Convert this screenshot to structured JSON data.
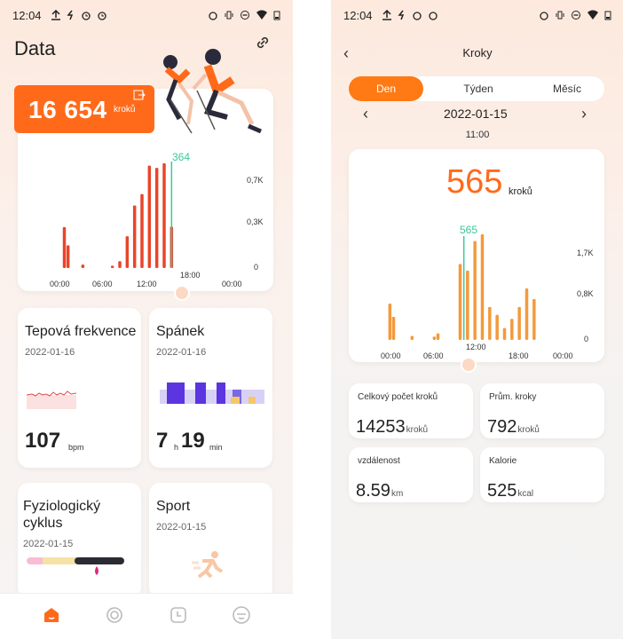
{
  "status_bar": {
    "time": "12:04"
  },
  "left": {
    "title": "Data",
    "steps": {
      "value": "16 654",
      "unit": "kroků"
    },
    "chart": {
      "highlight_label": "364",
      "y_labels": [
        "0,7K",
        "0,3K",
        "0"
      ],
      "x_labels": [
        "00:00",
        "06:00",
        "12:00",
        "18:00",
        "00:00"
      ]
    },
    "heart": {
      "title": "Tepová frekvence",
      "date": "2022-01-16",
      "value": "107",
      "unit": "bpm"
    },
    "sleep": {
      "title": "Spánek",
      "date": "2022-01-16",
      "hours": "7",
      "h_unit": "h",
      "minutes": "19",
      "min_unit": "min"
    },
    "cycle": {
      "title_line1": "Fyziologický",
      "title_line2": "cyklus",
      "date": "2022-01-15"
    },
    "sport": {
      "title": "Sport",
      "date": "2022-01-15"
    },
    "nav": [
      "home-icon",
      "activity-icon",
      "clock-icon",
      "profile-icon"
    ]
  },
  "right": {
    "title": "Kroky",
    "tabs": [
      {
        "label": "Den",
        "active": true
      },
      {
        "label": "Týden",
        "active": false
      },
      {
        "label": "Měsíc",
        "active": false
      }
    ],
    "date": "2022-01-15",
    "hour": "11:00",
    "big_value": "565",
    "big_unit": "kroků",
    "chart": {
      "highlight_label": "565",
      "y_labels": [
        "1,7K",
        "0,8K",
        "0"
      ],
      "x_labels": [
        "00:00",
        "06:00",
        "12:00",
        "18:00",
        "00:00"
      ]
    },
    "stats": [
      {
        "label": "Celkový počet kroků",
        "value": "14253",
        "unit": "kroků"
      },
      {
        "label": "Prům. kroky",
        "value": "792",
        "unit": "kroků"
      },
      {
        "label": "vzdálenost",
        "value": "8.59",
        "unit": "km"
      },
      {
        "label": "Kalorie",
        "value": "525",
        "unit": "kcal"
      }
    ]
  },
  "colors": {
    "accent": "#ff6a1a",
    "bar_left": "#e8452c",
    "bar_right": "#f39a3c",
    "highlight": "#3cc79a"
  },
  "chart_data": [
    {
      "type": "bar",
      "x_range": [
        "00:00",
        "00:00"
      ],
      "x_labels": [
        "00:00",
        "06:00",
        "12:00",
        "18:00",
        "00:00"
      ],
      "y_ticks": [
        "0",
        "0,3K",
        "0,7K"
      ],
      "values": [
        {
          "x": 1.5,
          "y": 0.36
        },
        {
          "x": 2,
          "y": 0.2
        },
        {
          "x": 4,
          "y": 0.03
        },
        {
          "x": 8,
          "y": 0.02
        },
        {
          "x": 9,
          "y": 0.06
        },
        {
          "x": 10,
          "y": 0.28
        },
        {
          "x": 11,
          "y": 0.55
        },
        {
          "x": 12,
          "y": 0.65
        },
        {
          "x": 13,
          "y": 0.9
        },
        {
          "x": 14,
          "y": 0.88
        },
        {
          "x": 15,
          "y": 0.92
        },
        {
          "x": 16,
          "y": 0.364
        }
      ],
      "highlight": {
        "x": 16,
        "y": 0.364,
        "label": "364"
      }
    },
    {
      "type": "bar",
      "x_labels": [
        "00:00",
        "06:00",
        "12:00",
        "18:00",
        "00:00"
      ],
      "y_ticks": [
        "0",
        "0,8K",
        "1,7K"
      ],
      "values": [
        {
          "x": 1,
          "y": 0.55
        },
        {
          "x": 1.5,
          "y": 0.35
        },
        {
          "x": 4,
          "y": 0.06
        },
        {
          "x": 7,
          "y": 0.05
        },
        {
          "x": 7.5,
          "y": 0.1
        },
        {
          "x": 10.5,
          "y": 1.15
        },
        {
          "x": 11.5,
          "y": 1.05
        },
        {
          "x": 12.5,
          "y": 1.5
        },
        {
          "x": 13.5,
          "y": 1.6
        },
        {
          "x": 14.5,
          "y": 0.5
        },
        {
          "x": 15.5,
          "y": 0.38
        },
        {
          "x": 16.5,
          "y": 0.18
        },
        {
          "x": 17.5,
          "y": 0.32
        },
        {
          "x": 18.5,
          "y": 0.5
        },
        {
          "x": 19.5,
          "y": 0.78
        },
        {
          "x": 20.5,
          "y": 0.62
        }
      ],
      "highlight": {
        "x": 11,
        "y": 0.565,
        "label": "565"
      }
    }
  ]
}
